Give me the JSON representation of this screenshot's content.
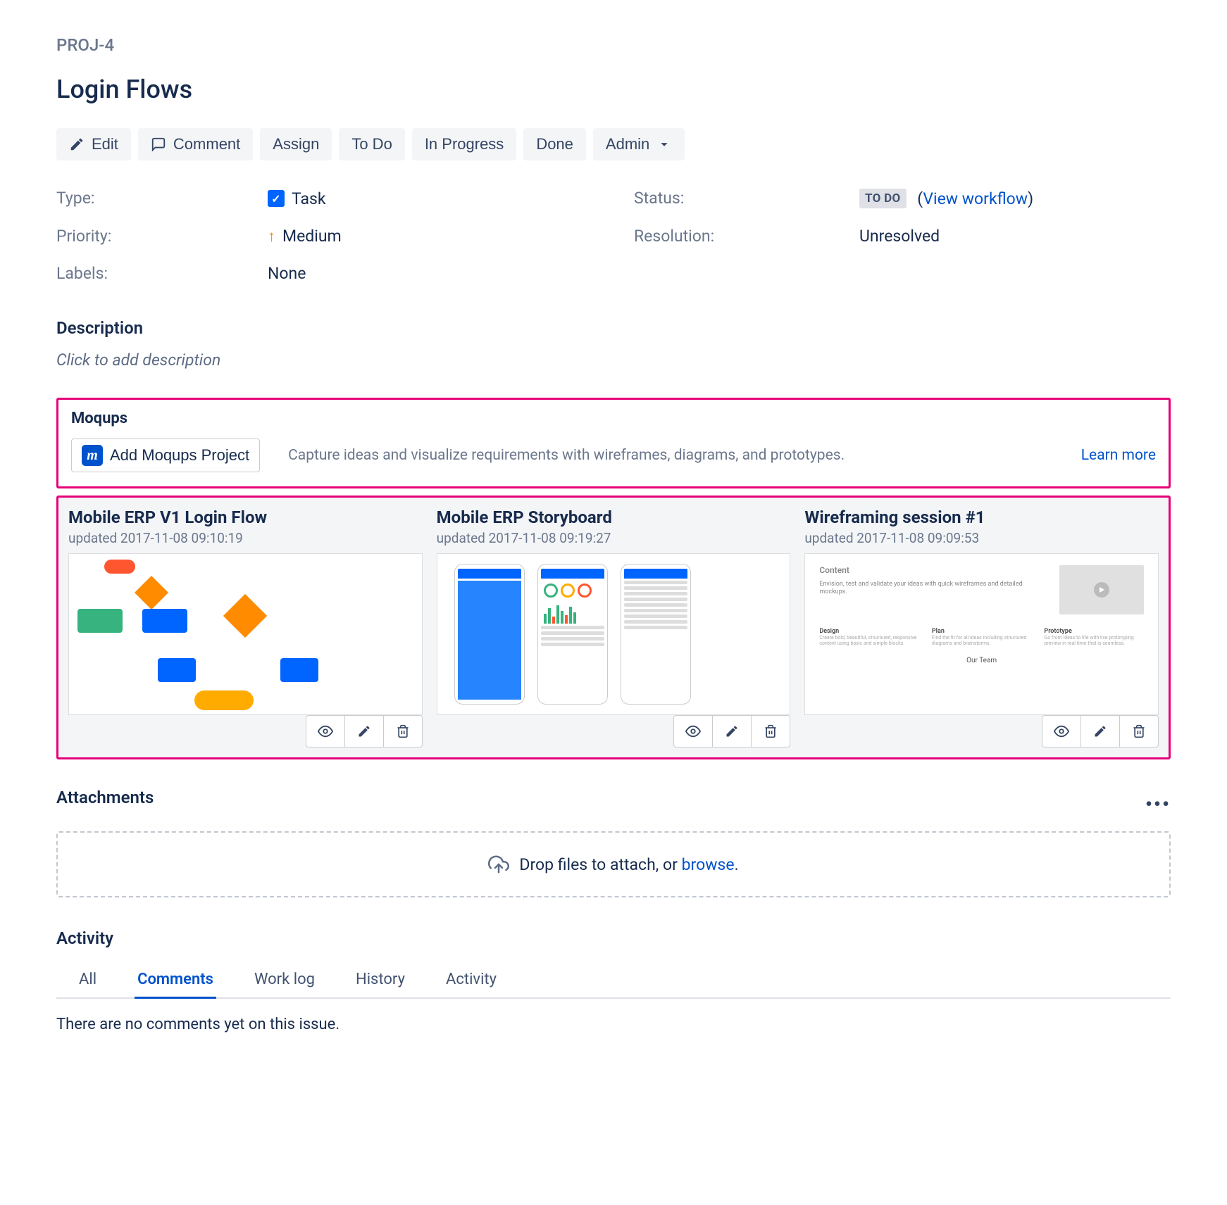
{
  "issue": {
    "key": "PROJ-4",
    "title": "Login Flows"
  },
  "toolbar": {
    "edit": "Edit",
    "comment": "Comment",
    "assign": "Assign",
    "todo": "To Do",
    "in_progress": "In Progress",
    "done": "Done",
    "admin": "Admin"
  },
  "details": {
    "type_label": "Type:",
    "type_value": "Task",
    "status_label": "Status:",
    "status_value": "TO DO",
    "view_workflow": "View workflow",
    "priority_label": "Priority:",
    "priority_value": "Medium",
    "resolution_label": "Resolution:",
    "resolution_value": "Unresolved",
    "labels_label": "Labels:",
    "labels_value": "None"
  },
  "description": {
    "heading": "Description",
    "placeholder": "Click to add description"
  },
  "moqups": {
    "heading": "Moqups",
    "add_button": "Add Moqups Project",
    "hint": "Capture ideas and visualize requirements with wireframes, diagrams, and prototypes.",
    "learn_more": "Learn more"
  },
  "projects": [
    {
      "title": "Mobile ERP V1 Login Flow",
      "updated": "updated 2017-11-08 09:10:19"
    },
    {
      "title": "Mobile ERP Storyboard",
      "updated": "updated 2017-11-08 09:19:27"
    },
    {
      "title": "Wireframing session #1",
      "updated": "updated 2017-11-08 09:09:53"
    }
  ],
  "thumb3": {
    "content_title": "Content",
    "content_text": "Envision, test and validate your ideas with quick wireframes and detailed mockups.",
    "col1_title": "Design",
    "col1_text": "Create bold, beautiful, structured, responsive content using basic and simple blocks.",
    "col2_title": "Plan",
    "col2_text": "Find the fit for all ideas including structured diagrams and brainstorms.",
    "col3_title": "Prototype",
    "col3_text": "Go from ideas to life with live prototyping preview in real time that is seamless.",
    "team": "Our Team"
  },
  "attachments": {
    "heading": "Attachments",
    "drop_prefix": "Drop files to attach, or ",
    "browse": "browse",
    "drop_suffix": "."
  },
  "activity": {
    "heading": "Activity",
    "tabs": {
      "all": "All",
      "comments": "Comments",
      "work_log": "Work log",
      "history": "History",
      "activity": "Activity"
    },
    "empty": "There are no comments yet on this issue."
  }
}
